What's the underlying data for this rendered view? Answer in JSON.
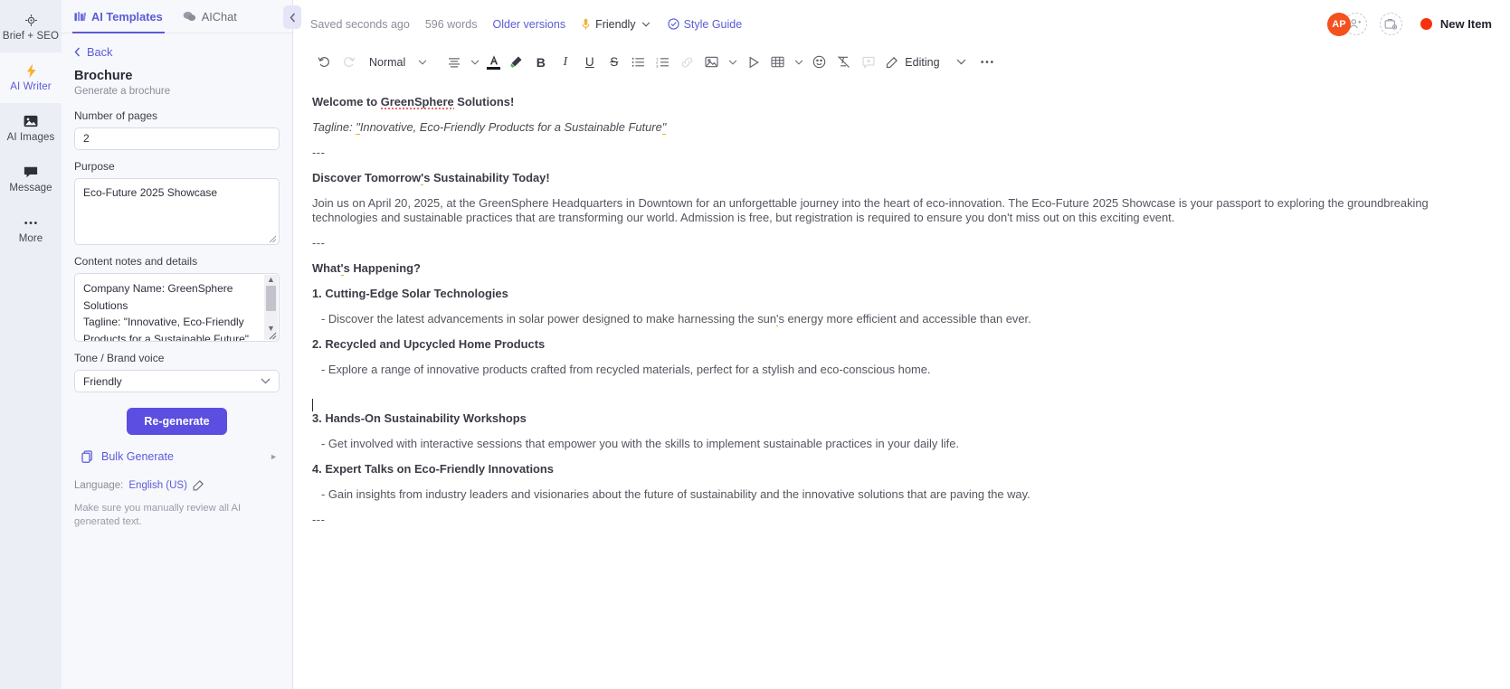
{
  "rail": {
    "items": [
      {
        "label": "Brief + SEO",
        "icon": "target-icon",
        "active": false
      },
      {
        "label": "AI Writer",
        "icon": "lightning-bolt-icon",
        "active": true
      },
      {
        "label": "AI Images",
        "icon": "image-icon",
        "active": false
      },
      {
        "label": "Message",
        "icon": "chat-bubble-icon",
        "active": false
      },
      {
        "label": "More",
        "icon": "ellipsis-icon",
        "active": false
      }
    ]
  },
  "panel": {
    "tabs": [
      {
        "label": "AI Templates",
        "icon": "templates-icon",
        "active": true
      },
      {
        "label": "AIChat",
        "icon": "chat-icon",
        "active": false
      }
    ],
    "back_label": "Back",
    "template_title": "Brochure",
    "template_subtitle": "Generate a brochure",
    "fields": {
      "pages_label": "Number of pages",
      "pages_value": "2",
      "purpose_label": "Purpose",
      "purpose_value": "Eco-Future 2025 Showcase",
      "notes_label": "Content notes and details",
      "notes_value": "Company Name: GreenSphere Solutions\nTagline: \"Innovative, Eco-Friendly Products for a Sustainable Future\"",
      "tone_label": "Tone / Brand voice",
      "tone_value": "Friendly"
    },
    "regenerate_label": "Re-generate",
    "bulk_generate_label": "Bulk Generate",
    "language_prefix": "Language:",
    "language_value": "English (US)",
    "disclaimer": "Make sure you manually review all AI generated text."
  },
  "doc_header": {
    "saved_status": "Saved seconds ago",
    "word_count": "596 words",
    "older_versions": "Older versions",
    "tone": "Friendly",
    "style_guide": "Style Guide",
    "avatar_initials": "AP",
    "new_item_label": "New Item",
    "accent_color": "#5b5bd6",
    "avatar_color": "#f4511e",
    "dot_color": "#f4330e"
  },
  "toolbar": {
    "undo": "undo-icon",
    "redo": "redo-icon",
    "style_value": "Normal",
    "editing_label": "Editing",
    "items": [
      "align-icon",
      "font-color-icon",
      "highlight-icon",
      "bold-icon",
      "italic-icon",
      "underline-icon",
      "strikethrough-icon",
      "bulleted-list-icon",
      "numbered-list-icon",
      "link-icon",
      "image-icon",
      "video-icon",
      "table-icon",
      "emoji-icon",
      "clear-format-icon",
      "comment-icon",
      "pencil-icon"
    ]
  },
  "document": {
    "blocks": [
      {
        "type": "heading",
        "text": "Welcome to GreenSphere Solutions!"
      },
      {
        "type": "italic",
        "text": "Tagline: \"Innovative, Eco-Friendly Products for a Sustainable Future\""
      },
      {
        "type": "rule",
        "text": "---"
      },
      {
        "type": "heading",
        "text": "Discover Tomorrow's Sustainability Today!"
      },
      {
        "type": "paragraph",
        "text": "Join us on April 20, 2025, at the GreenSphere Headquarters in Downtown for an unforgettable journey into the heart of eco-innovation. The Eco-Future 2025 Showcase is your passport to exploring the groundbreaking technologies and sustainable practices that are transforming our world. Admission is free, but registration is required to ensure you don't miss out on this exciting event."
      },
      {
        "type": "rule",
        "text": "---"
      },
      {
        "type": "heading",
        "text": "What's Happening?"
      },
      {
        "type": "heading",
        "text": "1. Cutting-Edge Solar Technologies"
      },
      {
        "type": "sub",
        "text": "- Discover the latest advancements in solar power designed to make harnessing the sun's energy more efficient and accessible than ever."
      },
      {
        "type": "heading",
        "text": "2. Recycled and Upcycled Home Products"
      },
      {
        "type": "sub",
        "text": "- Explore a range of innovative products crafted from recycled materials, perfect for a stylish and eco-conscious home."
      },
      {
        "type": "caret",
        "text": ""
      },
      {
        "type": "heading",
        "text": "3. Hands-On Sustainability Workshops"
      },
      {
        "type": "sub",
        "text": "- Get involved with interactive sessions that empower you with the skills to implement sustainable practices in your daily life."
      },
      {
        "type": "heading",
        "text": "4. Expert Talks on Eco-Friendly Innovations"
      },
      {
        "type": "sub",
        "text": "- Gain insights from industry leaders and visionaries about the future of sustainability and the innovative solutions that are paving the way."
      },
      {
        "type": "rule",
        "text": "---"
      }
    ]
  }
}
